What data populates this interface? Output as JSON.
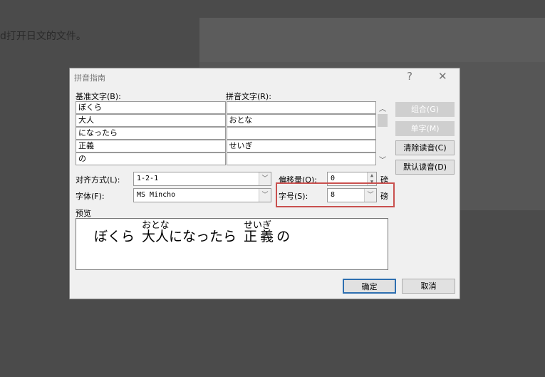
{
  "background": {
    "instruction_text": "d打开日文的文件。"
  },
  "dialog": {
    "title": "拼音指南",
    "help_label": "?",
    "close_label": "✕",
    "base_text_label": "基准文字(B):",
    "ruby_text_label": "拼音文字(R):",
    "rows": [
      {
        "base": "ぼくら",
        "ruby": ""
      },
      {
        "base": "大人",
        "ruby": "おとな"
      },
      {
        "base": "になったら",
        "ruby": ""
      },
      {
        "base": "正義",
        "ruby": "せいぎ"
      },
      {
        "base": "の",
        "ruby": ""
      }
    ],
    "buttons": {
      "group": "组合(G)",
      "mono": "单字(M)",
      "clear": "清除读音(C)",
      "default": "默认读音(D)",
      "ok": "确定",
      "cancel": "取消"
    },
    "alignment": {
      "label": "对齐方式(L):",
      "value": "1-2-1"
    },
    "offset": {
      "label": "偏移量(O):",
      "value": "0",
      "unit": "磅"
    },
    "font": {
      "label": "字体(F):",
      "value": "MS Mincho"
    },
    "size": {
      "label": "字号(S):",
      "value": "8",
      "unit": "磅"
    },
    "preview": {
      "label": "预览",
      "segments": [
        {
          "base": "ぼくら",
          "ruby": ""
        },
        {
          "base": "大人",
          "ruby": "おとな"
        },
        {
          "base": "になったら",
          "ruby": ""
        },
        {
          "base": "正義",
          "ruby": "せいぎ"
        },
        {
          "base": "の",
          "ruby": ""
        }
      ]
    },
    "highlight_color": "#c9504e"
  }
}
